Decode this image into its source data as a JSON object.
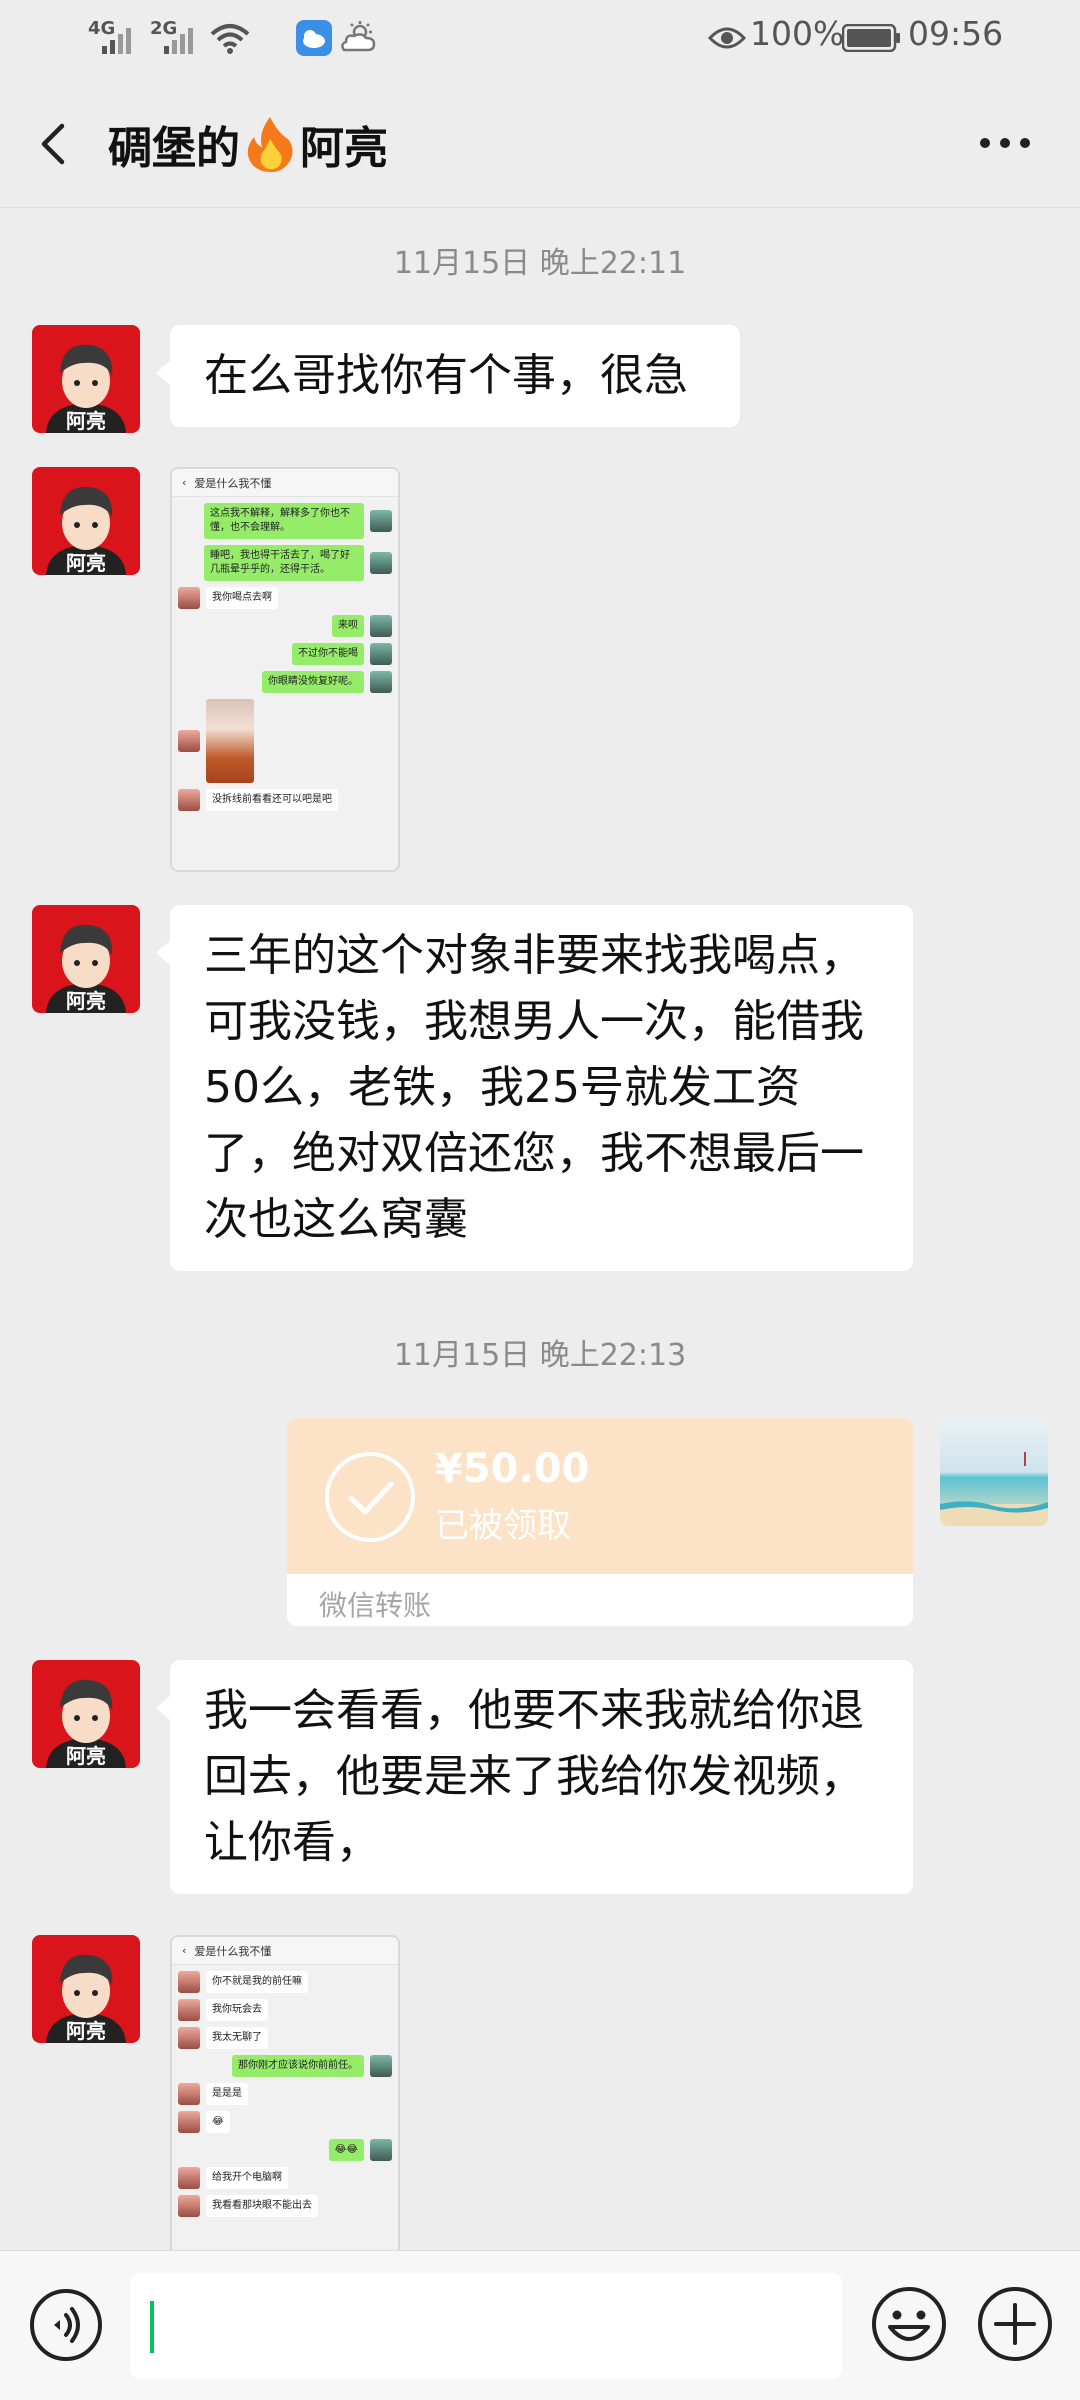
{
  "status_bar": {
    "signal_1": "4G",
    "signal_2": "2G",
    "battery_percent": "100%",
    "time": "09:56",
    "icons": [
      "signal-4g-icon",
      "signal-2g-icon",
      "wifi-icon",
      "weather-app-icon",
      "weather-sun-cloud-icon",
      "eye-icon",
      "battery-icon"
    ]
  },
  "header": {
    "title_before": "碉堡的",
    "title_after": "阿亮",
    "title_emoji": "flame-icon",
    "back_icon": "back-chevron-icon",
    "more_icon": "more-dots-icon"
  },
  "contact": {
    "avatar_label": "阿亮"
  },
  "messages": [
    {
      "type": "timestamp",
      "text": "11月15日 晚上22:11"
    },
    {
      "type": "text",
      "from": "contact",
      "text": "在么哥找你有个事，很急"
    },
    {
      "type": "image",
      "from": "contact",
      "screenshot": {
        "title": "爱是什么我不懂",
        "rows": [
          {
            "side": "right",
            "text": "这点我不解释，解释多了你也不懂，也不会理解。"
          },
          {
            "side": "right",
            "text": "睡吧，我也得干活去了，喝了好几瓶晕乎乎的，还得干活。"
          },
          {
            "side": "left",
            "text": "我你喝点去啊"
          },
          {
            "side": "right",
            "text": "来呗"
          },
          {
            "side": "right",
            "text": "不过你不能喝"
          },
          {
            "side": "right",
            "text": "你眼睛没恢复好呢。"
          },
          {
            "side": "left",
            "text": "",
            "photo": true
          },
          {
            "side": "left",
            "text": "没拆线前看看还可以吧是吧"
          }
        ]
      }
    },
    {
      "type": "text",
      "from": "contact",
      "text": "三年的这个对象非要来找我喝点，可我没钱，我想男人一次，能借我50么，老铁，我25号就发工资了，绝对双倍还您，我不想最后一次也这么窝囊"
    },
    {
      "type": "timestamp",
      "text": "11月15日 晚上22:13"
    },
    {
      "type": "transfer",
      "from": "me",
      "amount": "¥50.00",
      "status": "已被领取",
      "label": "微信转账"
    },
    {
      "type": "text",
      "from": "contact",
      "text": "我一会看看，他要不来我就给你退回去，他要是来了我给你发视频，让你看，"
    },
    {
      "type": "image",
      "from": "contact",
      "screenshot": {
        "title": "爱是什么我不懂",
        "rows": [
          {
            "side": "left",
            "text": "你不就是我的前任嘛"
          },
          {
            "side": "left",
            "text": "我你玩会去"
          },
          {
            "side": "left",
            "text": "我太无聊了"
          },
          {
            "side": "right",
            "text": "那你刚才应该说你前前任。"
          },
          {
            "side": "left",
            "text": "是是是"
          },
          {
            "side": "left",
            "text": "😂"
          },
          {
            "side": "right",
            "text": "😂😂"
          },
          {
            "side": "left",
            "text": "给我开个电脑啊"
          },
          {
            "side": "left",
            "text": "我看看那块眼不能出去"
          }
        ]
      }
    }
  ],
  "input_bar": {
    "voice_icon": "voice-input-icon",
    "emoji_icon": "emoji-icon",
    "plus_icon": "plus-icon",
    "value": ""
  },
  "colors": {
    "background": "#ededed",
    "bubble": "#ffffff",
    "transfer": "#fce3c7",
    "accent": "#07c160",
    "my_bubble": "#95ec69"
  }
}
